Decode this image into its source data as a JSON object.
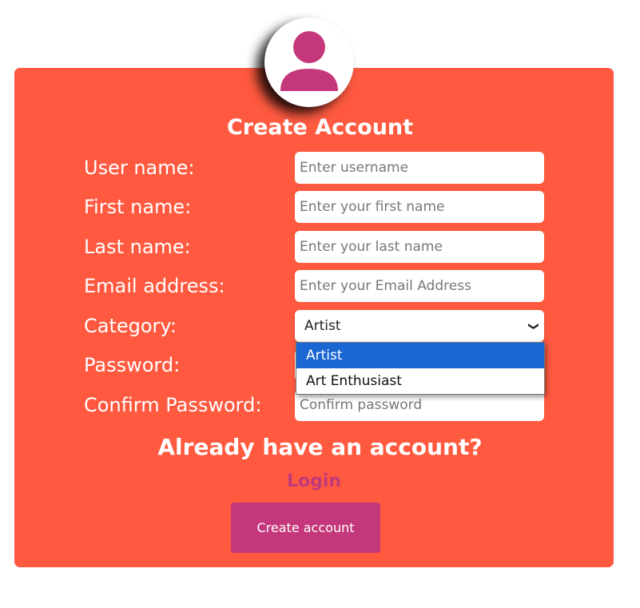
{
  "title": "Create Account",
  "fields": [
    {
      "label": "User name:",
      "placeholder": "Enter username"
    },
    {
      "label": "First name:",
      "placeholder": "Enter your first name"
    },
    {
      "label": "Last name:",
      "placeholder": "Enter your last name"
    },
    {
      "label": "Email address:",
      "placeholder": "Enter your Email Address"
    },
    {
      "label": "Category:",
      "value": "Artist",
      "options": [
        "Artist",
        "Art Enthusiast"
      ]
    },
    {
      "label": "Password:",
      "placeholder": ""
    },
    {
      "label": "Confirm Password:",
      "placeholder": "Confirm password"
    }
  ],
  "already": "Already have an account?",
  "login": "Login",
  "button": "Create account",
  "colors": {
    "card": "#ff5a40",
    "accent": "#c4377a",
    "highlight": "#1a66d2"
  }
}
